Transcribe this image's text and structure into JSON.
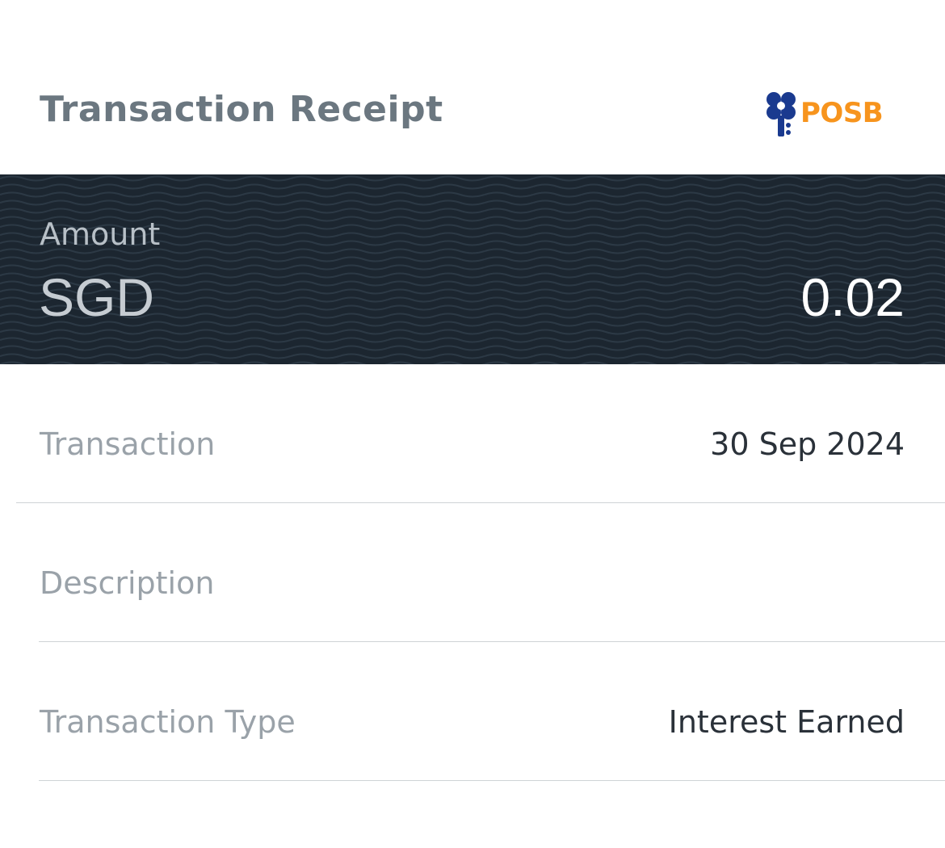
{
  "header": {
    "title": "Transaction Receipt",
    "logo_text": "POSB",
    "logo_color": "#f7941d",
    "logo_mark_color": "#1a3a8f"
  },
  "amount": {
    "label": "Amount",
    "currency": "SGD",
    "value": "0.02",
    "banner_color": "#1c2630"
  },
  "details": [
    {
      "label": "Transaction",
      "value": "30 Sep 2024"
    },
    {
      "label": "Description",
      "value": ""
    },
    {
      "label": "Transaction Type",
      "value": "Interest Earned"
    }
  ]
}
